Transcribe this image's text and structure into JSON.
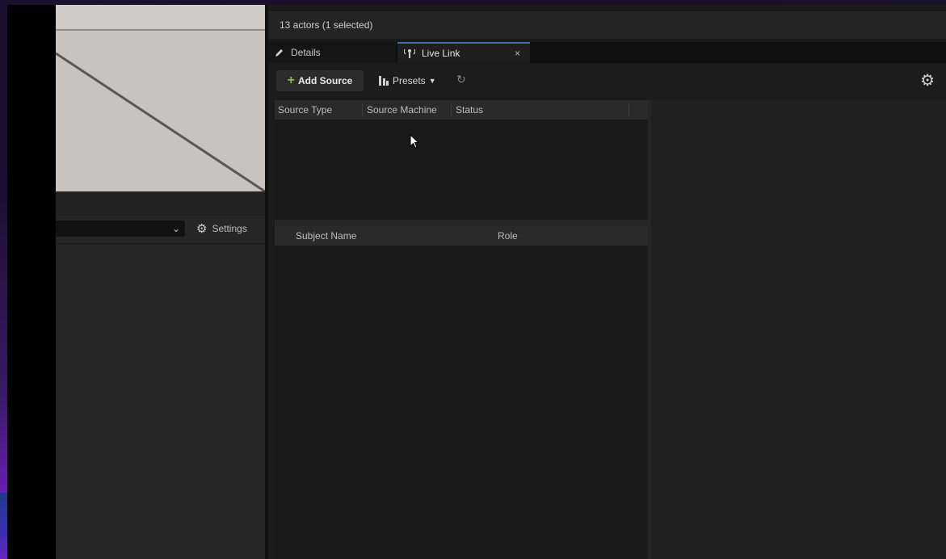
{
  "outliner": {
    "status": "13 actors (1 selected)"
  },
  "tabs": {
    "details_label": "Details",
    "live_link_label": "Live Link",
    "close_glyph": "×"
  },
  "left_panel": {
    "settings_label": "Settings"
  },
  "live_link": {
    "toolbar": {
      "add_source_label": "Add Source",
      "presets_label": "Presets"
    },
    "sources_table": {
      "columns": [
        "Source Type",
        "Source Machine",
        "Status"
      ]
    },
    "subjects_table": {
      "columns": [
        "Subject Name",
        "Role"
      ]
    }
  },
  "colors": {
    "accent_green": "#7dc04a",
    "tab_highlight": "#3a6ea5",
    "background_purple": "#7a1fd0"
  },
  "icons": [
    "pencil-icon",
    "live-link-icon",
    "close-icon",
    "plus-icon",
    "presets-icon",
    "chevron-down-icon",
    "refresh-icon",
    "gear-icon",
    "settings-gear-icon",
    "mouse-cursor-icon"
  ]
}
